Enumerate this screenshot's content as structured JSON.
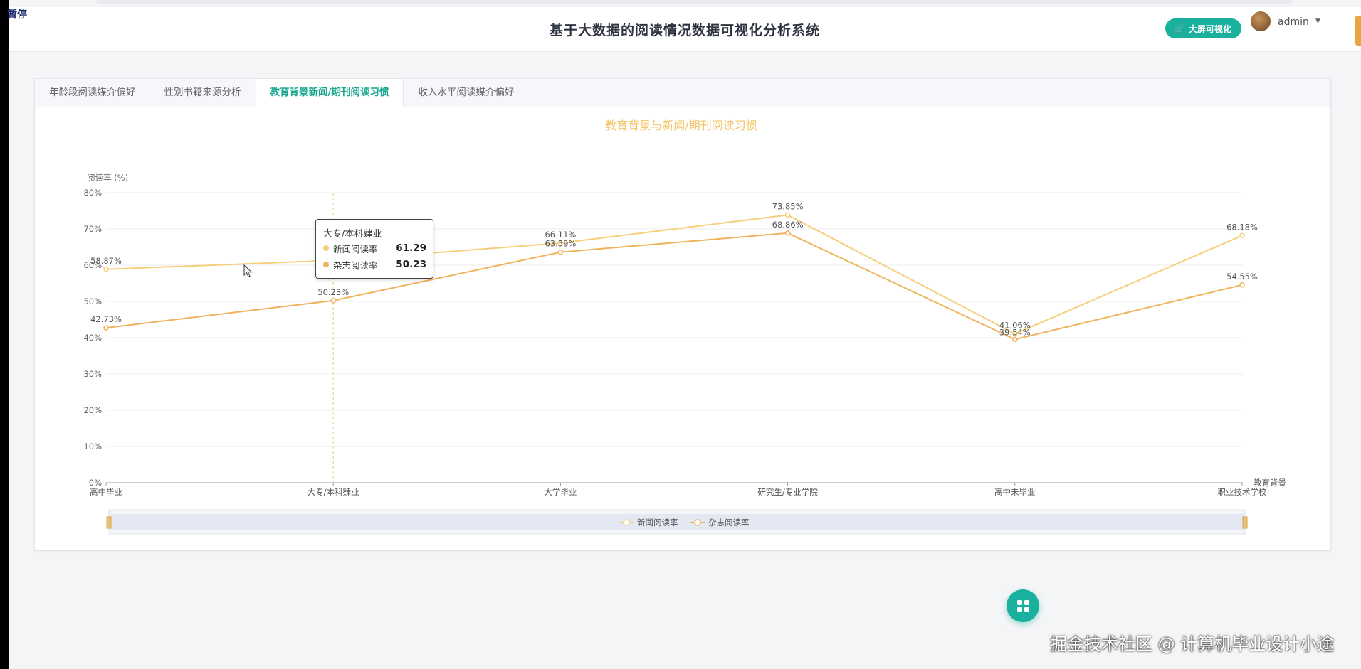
{
  "overlay": {
    "pause_label": "暂停"
  },
  "header": {
    "title": "基于大数据的阅读情况数据可视化分析系统",
    "bigscreen_label": "大屏可视化",
    "user_name": "admin"
  },
  "tabs": [
    {
      "label": "年龄段阅读媒介偏好"
    },
    {
      "label": "性别书籍来源分析"
    },
    {
      "label": "教育背景新闻/期刊阅读习惯"
    },
    {
      "label": "收入水平阅读媒介偏好"
    }
  ],
  "colors": {
    "accent": "#19b19d",
    "series_news": "#f6cf7a",
    "series_magazine": "#efb35c",
    "title": "#f3c56a"
  },
  "chart_data": {
    "type": "line",
    "title": "教育背景与新闻/期刊阅读习惯",
    "ylabel": "阅读率 (%)",
    "xlabel": "教育背景",
    "ylim": [
      0,
      80
    ],
    "y_ticks": [
      "0%",
      "10%",
      "20%",
      "30%",
      "40%",
      "50%",
      "60%",
      "70%",
      "80%"
    ],
    "categories": [
      "高中毕业",
      "大专/本科肄业",
      "大学毕业",
      "研究生/专业学院",
      "高中未毕业",
      "职业技术学校"
    ],
    "series": [
      {
        "name": "新闻阅读率",
        "values": [
          58.87,
          61.29,
          66.11,
          73.85,
          41.06,
          68.18
        ],
        "labels": [
          "58.87%",
          "",
          "66.11%",
          "73.85%",
          "41.06%",
          "68.18%"
        ]
      },
      {
        "name": "杂志阅读率",
        "values": [
          42.73,
          50.23,
          63.59,
          68.86,
          39.54,
          54.55
        ],
        "labels": [
          "42.73%",
          "50.23%",
          "63.59%",
          "68.86%",
          "39.54%",
          "54.55%"
        ]
      }
    ],
    "legend_position": "bottom",
    "tooltip": {
      "title": "大专/本科肄业",
      "rows": [
        {
          "name": "新闻阅读率",
          "value": "61.29"
        },
        {
          "name": "杂志阅读率",
          "value": "50.23"
        }
      ]
    }
  },
  "watermark": "掘金技术社区 @ 计算机毕业设计小途"
}
